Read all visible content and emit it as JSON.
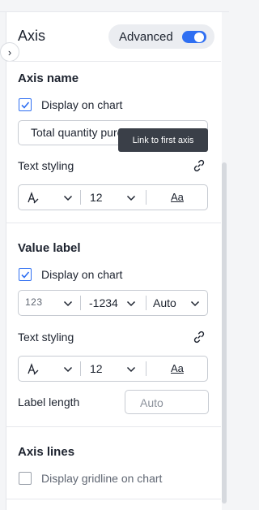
{
  "header": {
    "title": "Axis",
    "advanced_label": "Advanced",
    "advanced_on": true
  },
  "axis_name": {
    "title": "Axis name",
    "display_label": "Display on chart",
    "display_checked": true,
    "name_value": "Total quantity purchased",
    "tooltip": "Link to first axis",
    "text_styling_label": "Text styling",
    "font_size": "12",
    "aa_label": "Aa"
  },
  "value_label": {
    "title": "Value label",
    "display_label": "Display on chart",
    "display_checked": true,
    "number_icon": "123",
    "format_value": "-1234",
    "units_value": "Auto",
    "text_styling_label": "Text styling",
    "font_size": "12",
    "aa_label": "Aa",
    "label_length_label": "Label length",
    "label_length_placeholder": "Auto"
  },
  "axis_lines": {
    "title": "Axis lines",
    "gridline_label": "Display gridline on chart",
    "gridline_checked": false
  },
  "colors": {
    "accent": "#2f6ff2",
    "text": "#1d232f",
    "border": "#c7cbd2",
    "tooltip_bg": "#3a3f48"
  },
  "icons": [
    "chevron-right-icon",
    "checkmark-icon",
    "link-icon",
    "text-color-icon",
    "chevron-down-icon",
    "number-format-icon",
    "font-style-icon"
  ]
}
